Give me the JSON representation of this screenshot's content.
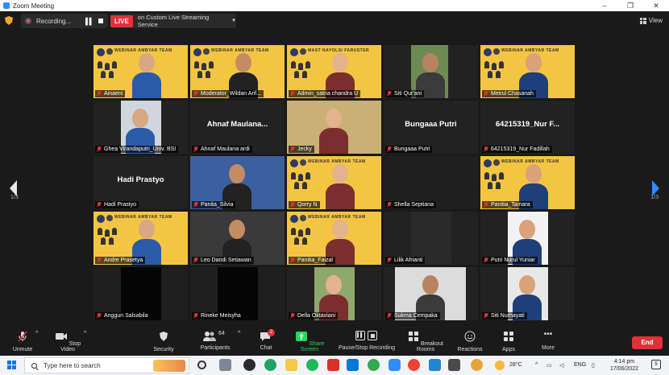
{
  "window": {
    "title": "Zoom Meeting",
    "controls": [
      "–",
      "❐",
      "✕"
    ]
  },
  "topbar": {
    "recording_label": "Recording...",
    "live_badge": "LIVE",
    "live_label": "on Custom Live Streaming Service",
    "view_label": "View"
  },
  "gallery": {
    "page_indicator_left": "1/3",
    "page_indicator_right": "1/3",
    "poster_text": "WEBINAR AMBYAR TEAM",
    "poster_text_alt": "MAST NAYOLSI FARUSTER",
    "tiles": [
      {
        "name": "Ainaeni",
        "kind": "poster",
        "big": ""
      },
      {
        "name": "Moderator_Wildan Arif...",
        "kind": "poster",
        "big": ""
      },
      {
        "name": "Admin_satria chandra U",
        "kind": "poster",
        "big": ""
      },
      {
        "name": "Siti Qur'ani",
        "kind": "photo",
        "big": ""
      },
      {
        "name": "Meirul Chasanah",
        "kind": "poster",
        "big": ""
      },
      {
        "name": "Ghea Virandaputri_Univ. BSI",
        "kind": "photo",
        "big": ""
      },
      {
        "name": "Ahnaf Maulana ardi",
        "kind": "text",
        "big": "Ahnaf  Maulana..."
      },
      {
        "name": "Jecky",
        "kind": "photo",
        "big": ""
      },
      {
        "name": "Bungaaa Putri",
        "kind": "text",
        "big": "Bungaaa Putri"
      },
      {
        "name": "64215319_Nur Fadillah",
        "kind": "text",
        "big": "64215319_Nur F..."
      },
      {
        "name": "Hadi Prastyo",
        "kind": "text",
        "big": "Hadi Prastyo"
      },
      {
        "name": "Panita_Silvia",
        "kind": "photo",
        "big": ""
      },
      {
        "name": "Qorry N",
        "kind": "poster",
        "big": ""
      },
      {
        "name": "Shella Septiana",
        "kind": "black",
        "big": ""
      },
      {
        "name": "Panitia_Tamara",
        "kind": "poster",
        "big": ""
      },
      {
        "name": "Andre Prasetya",
        "kind": "poster",
        "big": ""
      },
      {
        "name": "Leo Dandi Setiawan",
        "kind": "photo",
        "big": ""
      },
      {
        "name": "Panitia_Faizal",
        "kind": "poster",
        "big": ""
      },
      {
        "name": "Lilik Afrianti",
        "kind": "photo",
        "big": ""
      },
      {
        "name": "Putri Nurul Yuniar",
        "kind": "photo",
        "big": ""
      },
      {
        "name": "Anggun Salsabila",
        "kind": "black",
        "big": ""
      },
      {
        "name": "Rineke Meisyha",
        "kind": "black",
        "big": ""
      },
      {
        "name": "Della Oktaviani",
        "kind": "photo",
        "big": ""
      },
      {
        "name": "Sukma Cempaka",
        "kind": "photo",
        "big": ""
      },
      {
        "name": "Siti Nurhayati",
        "kind": "photo",
        "big": ""
      }
    ]
  },
  "toolbar": {
    "unmute": "Unmute",
    "stop_video": "Stop Video",
    "security": "Security",
    "participants": "Participants",
    "participants_count": "64",
    "chat": "Chat",
    "chat_badge": "2",
    "share_screen": "Share Screen",
    "pause_recording": "Pause/Stop Recording",
    "breakout": "Breakout Rooms",
    "reactions": "Reactions",
    "apps": "Apps",
    "more": "More",
    "end": "End",
    "accent_green": "#23d959",
    "end_red": "#e0313a"
  },
  "taskbar": {
    "search_placeholder": "Type here to search",
    "weather": "28°C",
    "lang": "ENG",
    "time": "4:14 pm",
    "date": "17/06/2022",
    "notif_count": "5"
  }
}
